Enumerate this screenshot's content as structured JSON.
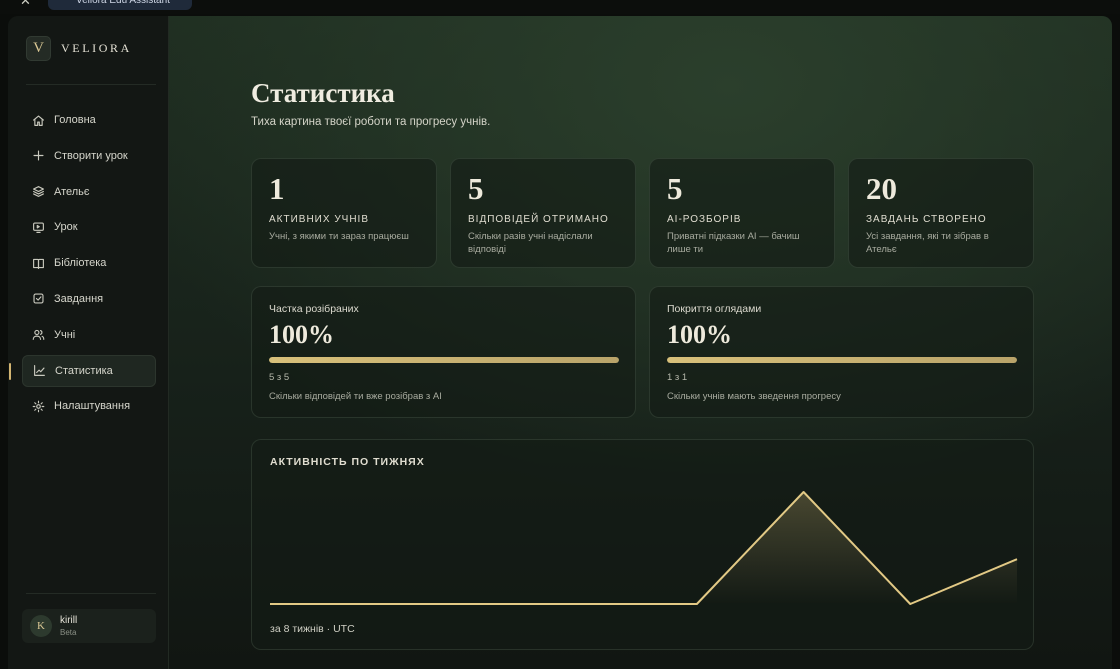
{
  "window": {
    "tab_title": "Veliora Edu Assistant"
  },
  "sidebar": {
    "brand_initial": "V",
    "brand_name": "VELIORA",
    "items": [
      {
        "label": "Головна",
        "icon": "home-icon"
      },
      {
        "label": "Створити урок",
        "icon": "plus-icon"
      },
      {
        "label": "Ательє",
        "icon": "layers-icon"
      },
      {
        "label": "Урок",
        "icon": "presentation-icon"
      },
      {
        "label": "Бібліотека",
        "icon": "book-icon"
      },
      {
        "label": "Завдання",
        "icon": "checkbox-icon"
      },
      {
        "label": "Учні",
        "icon": "users-icon"
      },
      {
        "label": "Статистика",
        "icon": "chart-line-icon",
        "active": true
      },
      {
        "label": "Налаштування",
        "icon": "gear-icon"
      }
    ],
    "user": {
      "initial": "K",
      "name": "kirill",
      "plan": "Beta"
    }
  },
  "main": {
    "title": "Статистика",
    "subtitle": "Тиха картина твоєї роботи та прогресу учнів.",
    "stats": [
      {
        "value": "1",
        "label": "АКТИВНИХ УЧНІВ",
        "desc": "Учні, з якими ти зараз працюєш"
      },
      {
        "value": "5",
        "label": "ВІДПОВІДЕЙ ОТРИМАНО",
        "desc": "Скільки разів учні надіслали відповіді"
      },
      {
        "value": "5",
        "label": "AI-РОЗБОРІВ",
        "desc": "Приватні підказки AI — бачиш лише ти"
      },
      {
        "value": "20",
        "label": "ЗАВДАНЬ СТВОРЕНО",
        "desc": "Усі завдання, які ти зібрав в Ательє"
      }
    ],
    "progress": [
      {
        "title": "Частка розібраних",
        "value": "100%",
        "fraction": 1.0,
        "count": "5 з 5",
        "desc": "Скільки відповідей ти вже розібрав з AI"
      },
      {
        "title": "Покриття оглядами",
        "value": "100%",
        "fraction": 1.0,
        "count": "1 з 1",
        "desc": "Скільки учнів мають зведення прогресу"
      }
    ]
  },
  "colors": {
    "accent": "#d8c07a",
    "line": "#e2c985"
  },
  "chart_data": {
    "type": "area",
    "title": "АКТИВНІСТЬ ПО ТИЖНЯХ",
    "footnote": "за 8 тижнів · UTC",
    "series": [
      {
        "values": [
          0,
          0,
          0,
          0,
          0,
          5,
          0,
          2
        ]
      }
    ],
    "ylim": [
      0,
      5
    ],
    "grid": false,
    "legend": "none"
  }
}
